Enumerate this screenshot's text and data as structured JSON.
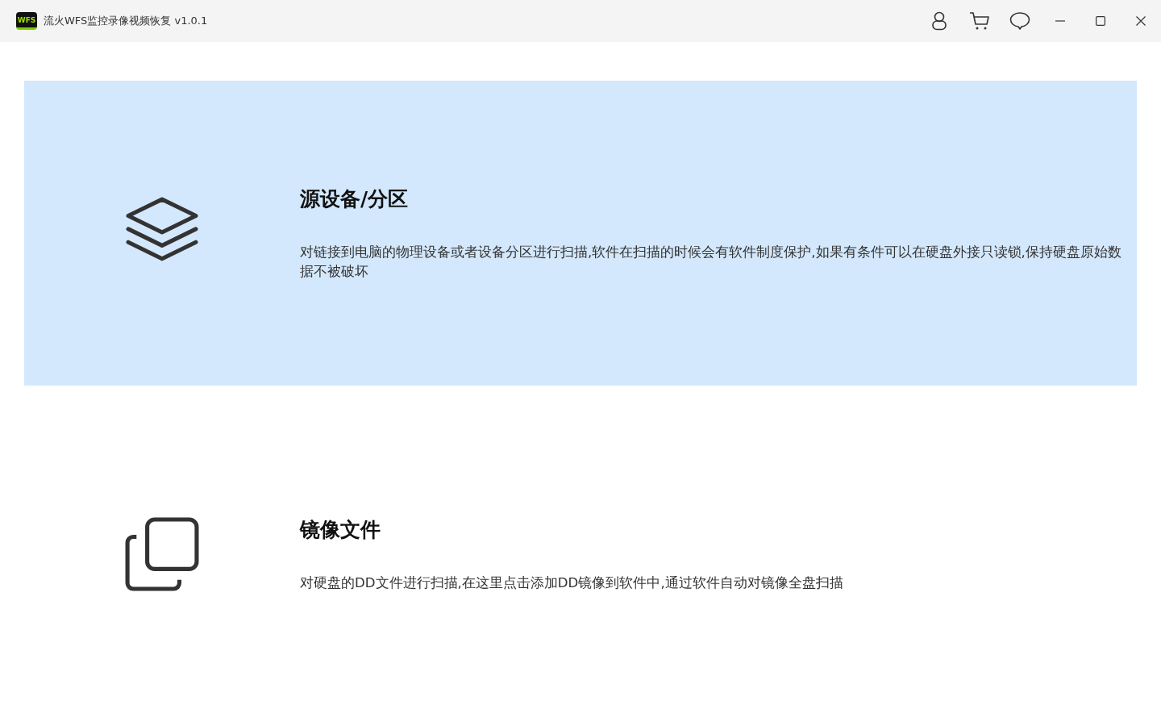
{
  "window": {
    "title": "流火WFS监控录像视频恢复 v1.0.1",
    "logo_text": "WFS"
  },
  "options": [
    {
      "kind": "layers",
      "title": "源设备/分区",
      "description": "对链接到电脑的物理设备或者设备分区进行扫描,软件在扫描的时候会有软件制度保护,如果有条件可以在硬盘外接只读锁,保持硬盘原始数据不被破坏",
      "selected": true
    },
    {
      "kind": "copy",
      "title": "镜像文件",
      "description": "对硬盘的DD文件进行扫描,在这里点击添加DD镜像到软件中,通过软件自动对镜像全盘扫描",
      "selected": false
    }
  ]
}
